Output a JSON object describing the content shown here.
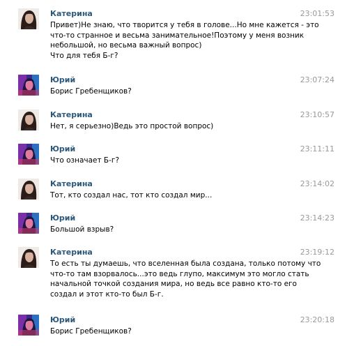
{
  "colors": {
    "name": "#2b587a",
    "time": "#999999",
    "text": "#000000",
    "background": "#ffffff"
  },
  "messages": [
    {
      "author": "Катерина",
      "avatar": "avatar-katerina",
      "time": "23:01:53",
      "lines": [
        "Привет)Не знаю, что творится у тебя в голове...Но мне кажется - это",
        "что-то странное и весьма занимательное!Поэтому у меня возник",
        "небольшой, но весьма важный вопрос)",
        "Что для тебя Б-г?"
      ]
    },
    {
      "author": "Юрий",
      "avatar": "avatar-yuriy",
      "time": "23:07:24",
      "lines": [
        "Борис Гребенщиков?"
      ]
    },
    {
      "author": "Катерина",
      "avatar": "avatar-katerina",
      "time": "23:10:57",
      "lines": [
        "Нет, я серьезно)Ведь это простой вопрос)"
      ]
    },
    {
      "author": "Юрий",
      "avatar": "avatar-yuriy",
      "time": "23:11:11",
      "lines": [
        "Что означает Б-г?"
      ]
    },
    {
      "author": "Катерина",
      "avatar": "avatar-katerina",
      "time": "23:14:02",
      "lines": [
        "Тот, кто создал нас, тот кто создал мир..."
      ]
    },
    {
      "author": "Юрий",
      "avatar": "avatar-yuriy",
      "time": "23:14:23",
      "lines": [
        "Большой взрыв?"
      ]
    },
    {
      "author": "Катерина",
      "avatar": "avatar-katerina",
      "time": "23:19:12",
      "lines": [
        "То есть ты думаешь, что вселенная была создана, только потому что",
        "что-то там взорвалось...это ведь глупо, максимум это могло стать",
        "начальной точкой создания мира, но ведь все равно кто-то его",
        "создал и этот кто-то был Б-г."
      ]
    },
    {
      "author": "Юрий",
      "avatar": "avatar-yuriy",
      "time": "23:20:18",
      "lines": [
        "Борис Гребенщиков?"
      ]
    }
  ]
}
